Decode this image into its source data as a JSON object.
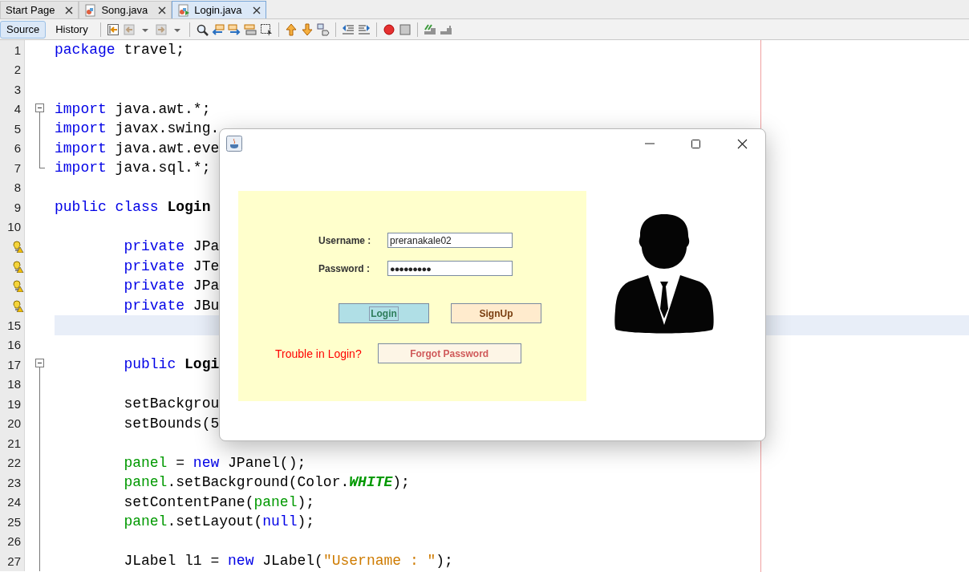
{
  "tabs": [
    {
      "label": "Start Page",
      "selected": false
    },
    {
      "label": "Song.java",
      "selected": false
    },
    {
      "label": "Login.java",
      "selected": true
    }
  ],
  "toolbar": {
    "modes": [
      {
        "label": "Source",
        "selected": true
      },
      {
        "label": "History",
        "selected": false
      }
    ]
  },
  "editor": {
    "lines": [
      {
        "number": "1",
        "kind": "plain",
        "current": false,
        "tokens": [
          {
            "kind": "keyword",
            "text": "package"
          },
          {
            "kind": "plain",
            "text": " travel;"
          }
        ]
      },
      {
        "number": "2",
        "kind": "plain",
        "current": false
      },
      {
        "number": "3",
        "kind": "plain",
        "current": false
      },
      {
        "number": "4",
        "kind": "fold",
        "current": false,
        "tokens": [
          {
            "kind": "keyword",
            "text": "import"
          },
          {
            "kind": "plain",
            "text": " java.awt.*;"
          }
        ]
      },
      {
        "number": "5",
        "kind": "fold-line",
        "current": false,
        "tokens": [
          {
            "kind": "keyword",
            "text": "import"
          },
          {
            "kind": "plain",
            "text": " javax.swing."
          }
        ]
      },
      {
        "number": "6",
        "kind": "fold-line",
        "current": false,
        "tokens": [
          {
            "kind": "keyword",
            "text": "import"
          },
          {
            "kind": "plain",
            "text": " java.awt.eve"
          }
        ]
      },
      {
        "number": "7",
        "kind": "fold-end",
        "current": false,
        "tokens": [
          {
            "kind": "keyword",
            "text": "import"
          },
          {
            "kind": "plain",
            "text": " java.sql.*;"
          }
        ]
      },
      {
        "number": "8",
        "kind": "plain",
        "current": false
      },
      {
        "number": "9",
        "kind": "plain",
        "current": false,
        "tokens": [
          {
            "kind": "keyword",
            "text": "public class"
          },
          {
            "kind": "bold",
            "text": " Login"
          }
        ]
      },
      {
        "number": "10",
        "kind": "plain",
        "current": false
      },
      {
        "kind": "warning",
        "current": false,
        "tokens": [
          {
            "kind": "keyword",
            "text": "        private"
          },
          {
            "kind": "plain",
            "text": " JPa"
          }
        ]
      },
      {
        "kind": "warning",
        "current": false,
        "tokens": [
          {
            "kind": "keyword",
            "text": "        private"
          },
          {
            "kind": "plain",
            "text": " JTe"
          }
        ]
      },
      {
        "kind": "warning",
        "current": false,
        "tokens": [
          {
            "kind": "keyword",
            "text": "        private"
          },
          {
            "kind": "plain",
            "text": " JPa"
          }
        ]
      },
      {
        "kind": "warning",
        "current": false,
        "tokens": [
          {
            "kind": "keyword",
            "text": "        private"
          },
          {
            "kind": "plain",
            "text": " JBu"
          }
        ]
      },
      {
        "number": "15",
        "kind": "plain",
        "current": true
      },
      {
        "number": "16",
        "kind": "plain",
        "current": false
      },
      {
        "number": "17",
        "kind": "fold",
        "current": false,
        "tokens": [
          {
            "kind": "keyword",
            "text": "        public"
          },
          {
            "kind": "bold",
            "text": " Logi"
          }
        ]
      },
      {
        "number": "18",
        "kind": "fold-line",
        "current": false
      },
      {
        "number": "19",
        "kind": "fold-line",
        "current": false,
        "tokens": [
          {
            "kind": "plain",
            "text": "        setBackgrou"
          }
        ]
      },
      {
        "number": "20",
        "kind": "fold-line",
        "current": false,
        "tokens": [
          {
            "kind": "plain",
            "text": "        setBounds(5"
          }
        ]
      },
      {
        "number": "21",
        "kind": "fold-line",
        "current": false
      },
      {
        "number": "22",
        "kind": "fold-line",
        "current": false,
        "tokens": [
          {
            "kind": "field",
            "text": "        panel"
          },
          {
            "kind": "plain",
            "text": " = "
          },
          {
            "kind": "keyword",
            "text": "new"
          },
          {
            "kind": "plain",
            "text": " JPanel();"
          }
        ]
      },
      {
        "number": "23",
        "kind": "fold-line",
        "current": false,
        "tokens": [
          {
            "kind": "field",
            "text": "        panel"
          },
          {
            "kind": "plain",
            "text": ".setBackground(Color."
          },
          {
            "kind": "constant",
            "text": "WHITE"
          },
          {
            "kind": "plain",
            "text": ");"
          }
        ]
      },
      {
        "number": "24",
        "kind": "fold-line",
        "current": false,
        "tokens": [
          {
            "kind": "plain",
            "text": "        setContentPane("
          },
          {
            "kind": "field",
            "text": "panel"
          },
          {
            "kind": "plain",
            "text": ");"
          }
        ]
      },
      {
        "number": "25",
        "kind": "fold-line",
        "current": false,
        "tokens": [
          {
            "kind": "field",
            "text": "        panel"
          },
          {
            "kind": "plain",
            "text": ".setLayout("
          },
          {
            "kind": "keyword",
            "text": "null"
          },
          {
            "kind": "plain",
            "text": ");"
          }
        ]
      },
      {
        "number": "26",
        "kind": "fold-line",
        "current": false
      },
      {
        "number": "27",
        "kind": "fold-line",
        "current": false,
        "tokens": [
          {
            "kind": "plain",
            "text": "        JLabel l1 = "
          },
          {
            "kind": "keyword",
            "text": "new"
          },
          {
            "kind": "plain",
            "text": " JLabel("
          },
          {
            "kind": "string",
            "text": "\"Username : \""
          },
          {
            "kind": "plain",
            "text": ");"
          }
        ]
      }
    ]
  },
  "dialog": {
    "fields": [
      {
        "label": "Username :",
        "kind": "text",
        "value": "preranakale02"
      },
      {
        "label": "Password :",
        "kind": "password",
        "value": "●●●●●●●●●"
      }
    ],
    "buttons": [
      {
        "label": "Login",
        "kind": "login",
        "focused": true
      },
      {
        "label": "SignUp",
        "kind": "signup",
        "focused": false
      }
    ],
    "help": {
      "text": "Trouble in Login?",
      "button": {
        "label": "Forgot Password",
        "kind": "forgot",
        "focused": false
      }
    }
  }
}
